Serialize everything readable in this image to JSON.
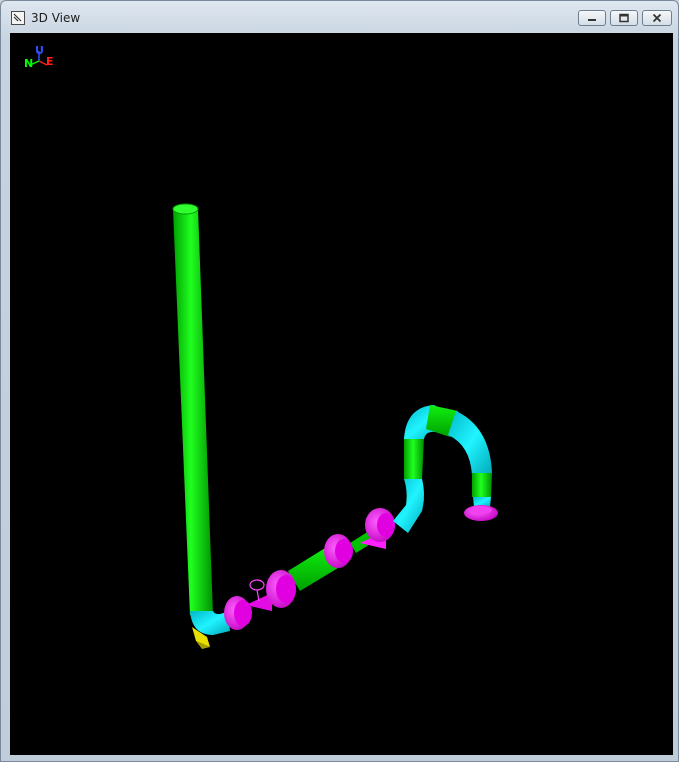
{
  "window": {
    "title": "3D View"
  },
  "controls": {
    "minimize": "minimize",
    "maximize": "maximize",
    "close": "close"
  },
  "orientation": {
    "north": "N",
    "up": "U",
    "east": "E"
  },
  "colors": {
    "background": "#000000",
    "pipe": "#00e000",
    "fitting": "#00e8f0",
    "flange": "#ff00ff",
    "support": "#e8e000"
  }
}
